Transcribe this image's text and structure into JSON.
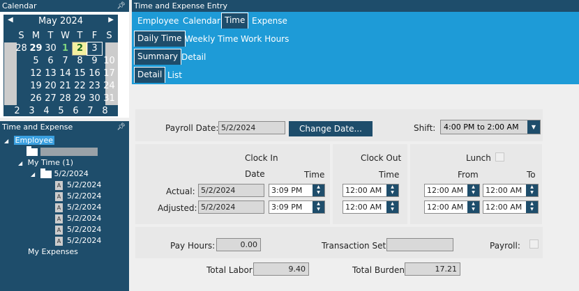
{
  "calendar_panel": {
    "title": "Calendar"
  },
  "calendar": {
    "month_label": "May 2024",
    "weekdays": [
      "S",
      "M",
      "T",
      "W",
      "T",
      "F",
      "S"
    ],
    "weeks": [
      [
        "28",
        "29",
        "30",
        "1",
        "2",
        "3"
      ],
      [
        "5",
        "6",
        "7",
        "8",
        "9",
        "10"
      ],
      [
        "12",
        "13",
        "14",
        "15",
        "16",
        "17"
      ],
      [
        "19",
        "20",
        "21",
        "22",
        "23",
        "24"
      ],
      [
        "26",
        "27",
        "28",
        "29",
        "30",
        "31"
      ],
      [
        "2",
        "3",
        "4",
        "5",
        "6",
        "7",
        "8"
      ]
    ],
    "week6_first": "2",
    "selected_day": "2"
  },
  "tree_panel": {
    "title": "Time and Expense"
  },
  "tree": {
    "employee": "Employee",
    "my_time": "My Time (1)",
    "date_folder": "5/2/2024",
    "entries": [
      "5/2/2024",
      "5/2/2024",
      "5/2/2024",
      "5/2/2024",
      "5/2/2024",
      "5/2/2024"
    ],
    "my_expenses": "My Expenses"
  },
  "main": {
    "title": "Time and Expense Entry"
  },
  "tabs": {
    "row1": [
      "Employee",
      "Calendar",
      "Time",
      "Expense"
    ],
    "row2": [
      "Daily Time",
      "Weekly Time",
      "Work Hours"
    ],
    "row3": [
      "Summary",
      "Detail"
    ],
    "row4": [
      "Detail",
      "List"
    ]
  },
  "form": {
    "payroll_date_label": "Payroll Date:",
    "payroll_date": "5/2/2024",
    "change_date_button": "Change Date...",
    "shift_label": "Shift:",
    "shift_value": "4:00 PM to 2:00 AM",
    "clock_in_label": "Clock In",
    "date_label": "Date",
    "time_label": "Time",
    "clock_out_label": "Clock Out",
    "clock_out_time_label": "Time",
    "lunch_label": "Lunch",
    "from_label": "From",
    "to_label": "To",
    "actual_label": "Actual:",
    "adjusted_label": "Adjusted:",
    "actual_date": "5/2/2024",
    "actual_time": "3:09 PM",
    "adjusted_date": "5/2/2024",
    "adjusted_time": "3:09 PM",
    "actual_out": "12:00 AM",
    "adjusted_out": "12:00 AM",
    "actual_lunch_from": "12:00 AM",
    "actual_lunch_to": "12:00 AM",
    "adjusted_lunch_from": "12:00 AM",
    "adjusted_lunch_to": "12:00 AM",
    "pay_hours_label": "Pay Hours:",
    "pay_hours": "0.00",
    "transaction_set_label": "Transaction Set:",
    "transaction_set": "",
    "payroll_label": "Payroll:",
    "total_labor_label": "Total Labor:",
    "total_labor": "9.40",
    "total_burden_label": "Total Burden:",
    "total_burden": "17.21"
  }
}
